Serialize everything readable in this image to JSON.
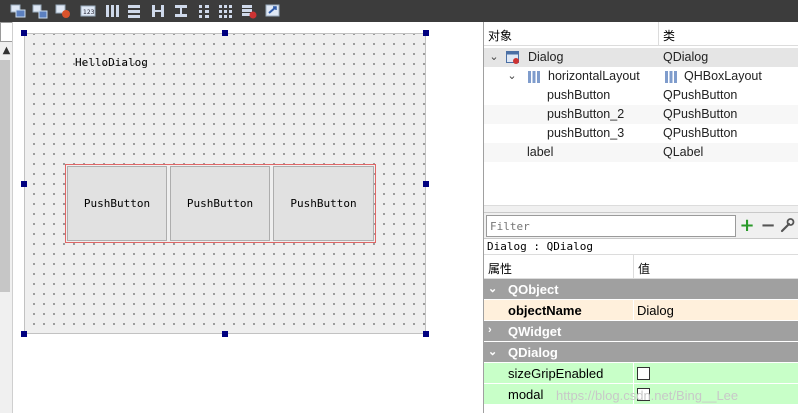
{
  "toolbar": {
    "buttons": [
      {
        "icon": "edit-widgets-icon"
      },
      {
        "icon": "edit-signals-slots-icon"
      },
      {
        "icon": "edit-buddies-icon"
      },
      {
        "icon": "edit-tab-order-icon"
      },
      {
        "icon": "layout-horizontal-icon"
      },
      {
        "icon": "layout-vertical-icon"
      },
      {
        "icon": "layout-horizontal-splitter-icon"
      },
      {
        "icon": "layout-vertical-splitter-icon"
      },
      {
        "icon": "layout-form-icon"
      },
      {
        "icon": "layout-grid-icon"
      },
      {
        "icon": "break-layout-icon"
      },
      {
        "icon": "adjust-size-icon"
      }
    ]
  },
  "form": {
    "label_text": "HelloDialog",
    "buttons": [
      "PushButton",
      "PushButton",
      "PushButton"
    ]
  },
  "object_inspector": {
    "col_object": "对象",
    "col_class": "类",
    "rows": [
      {
        "name": "Dialog",
        "class": "QDialog"
      },
      {
        "name": "horizontalLayout",
        "class": "QHBoxLayout"
      },
      {
        "name": "pushButton",
        "class": "QPushButton"
      },
      {
        "name": "pushButton_2",
        "class": "QPushButton"
      },
      {
        "name": "pushButton_3",
        "class": "QPushButton"
      },
      {
        "name": "label",
        "class": "QLabel"
      }
    ]
  },
  "property_editor": {
    "filter_placeholder": "Filter",
    "class_line": "Dialog : QDialog",
    "col_property": "属性",
    "col_value": "值",
    "groups": {
      "qobject": "QObject",
      "qwidget": "QWidget",
      "qdialog": "QDialog"
    },
    "props": {
      "object_name": {
        "name": "objectName",
        "value": "Dialog"
      },
      "size_grip": {
        "name": "sizeGripEnabled",
        "checked": false
      },
      "modal": {
        "name": "modal",
        "checked": false
      }
    }
  },
  "watermark": "https://blog.csdn.net/Bing__Lee",
  "colors": {
    "toolbar_bg": "#3c3c3c",
    "group_bg": "#a0a0a0",
    "object_name_row": "#fff0dc",
    "qdialog_rows": "#c8ffc8",
    "layout_outline": "#e06666",
    "selection_handle": "#000080"
  }
}
